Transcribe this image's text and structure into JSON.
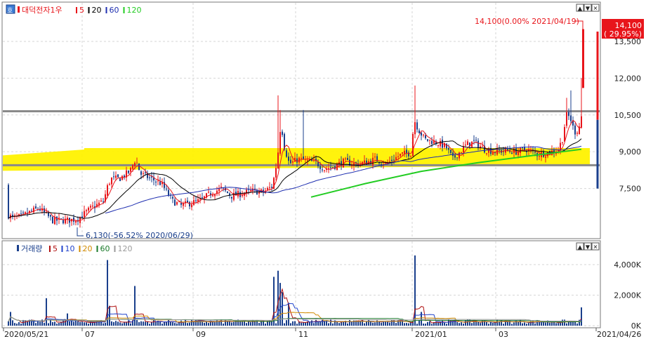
{
  "colors": {
    "up": "#e8151b",
    "down": "#1a3f8c",
    "ma5": "#e8151b",
    "ma20": "#000000",
    "ma60": "#1f2fb0",
    "ma120": "#22cc22",
    "highlight": "#fff200",
    "hline": "#8a8a8a",
    "vol_ma5": "#b01010",
    "vol_ma10": "#2244cc",
    "vol_ma20": "#d08a00",
    "vol_ma60": "#1a7a2a",
    "vol_ma120": "#9a9a9a"
  },
  "price_panel": {
    "icon": "호",
    "title": "대덕전자1우",
    "legend": [
      {
        "label": "5",
        "color": "#e8151b"
      },
      {
        "label": "20",
        "color": "#000000"
      },
      {
        "label": "60",
        "color": "#1f2fb0"
      },
      {
        "label": "120",
        "color": "#22cc22"
      }
    ],
    "high_label": "14,100(0.00% 2021/04/19)",
    "low_label": "6,130(-56.52% 2020/06/29)",
    "current_price": "14,100",
    "current_change": "( 29.95%)",
    "controls": [
      "▲",
      "▼",
      "✕"
    ]
  },
  "volume_panel": {
    "title": "거래량",
    "legend": [
      {
        "label": "5",
        "color": "#b01010"
      },
      {
        "label": "10",
        "color": "#2244cc"
      },
      {
        "label": "20",
        "color": "#d08a00"
      },
      {
        "label": "60",
        "color": "#1a7a2a"
      },
      {
        "label": "120",
        "color": "#9a9a9a"
      }
    ],
    "controls": [
      "▲",
      "▼",
      "✕"
    ]
  },
  "x_axis": {
    "labels": [
      "2020/05/21",
      "07",
      "09",
      "11",
      "2021/01",
      "03",
      "2021/04/26"
    ]
  },
  "chart_data": [
    {
      "type": "candlestick",
      "title": "대덕전자1우",
      "ylim": [
        6000,
        14100
      ],
      "y_ticks": [
        "7,500",
        "9,000",
        "10,500",
        "12,000",
        "13,500"
      ],
      "y_tick_values": [
        7500,
        9000,
        10500,
        12000,
        13500
      ],
      "horizontal_lines": [
        10650,
        8450
      ],
      "highlight_band": [
        8450,
        9150
      ],
      "x_dates": [
        "2020/05/21",
        "2020/07",
        "2020/09",
        "2020/11",
        "2021/01",
        "2021/03",
        "2021/04/26"
      ],
      "key_points": [
        {
          "date": "2020/06/29",
          "price": 6130,
          "label": "low"
        },
        {
          "date": "2021/04/19",
          "price": 14100,
          "label": "high"
        }
      ],
      "series": [
        {
          "name": "5",
          "type": "line"
        },
        {
          "name": "20",
          "type": "line"
        },
        {
          "name": "60",
          "type": "line"
        },
        {
          "name": "120",
          "type": "line"
        }
      ]
    },
    {
      "type": "bar",
      "title": "거래량",
      "ylim": [
        0,
        4800
      ],
      "y_ticks": [
        "0K",
        "2,000K",
        "4,000K"
      ],
      "y_tick_values": [
        0,
        2000,
        4000
      ]
    }
  ]
}
